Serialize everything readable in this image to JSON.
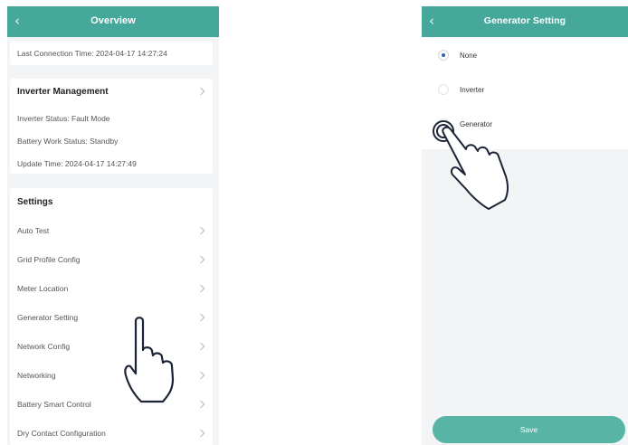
{
  "overview": {
    "header": {
      "back_icon": "chevron-left-icon",
      "title": "Overview"
    },
    "connection": {
      "last_connection": "Last Connection Time: 2024-04-17 14:27:24"
    },
    "inverter_management": {
      "title": "Inverter Management",
      "inverter_status": "Inverter Status: Fault Mode",
      "battery_work_status": "Battery Work Status: Standby",
      "update_time": "Update Time: 2024-04-17 14:27:49"
    },
    "settings": {
      "title": "Settings",
      "items": [
        {
          "label": "Auto Test"
        },
        {
          "label": "Grid Profile Config"
        },
        {
          "label": "Meter Location"
        },
        {
          "label": "Generator Setting"
        },
        {
          "label": "Network Config"
        },
        {
          "label": "Networking"
        },
        {
          "label": "Battery Smart Control"
        },
        {
          "label": "Dry Contact Configuration"
        }
      ]
    }
  },
  "generator_setting": {
    "header": {
      "back_icon": "chevron-left-icon",
      "title": "Generator Setting"
    },
    "options": [
      {
        "label": "None",
        "selected": true
      },
      {
        "label": "Inverter",
        "selected": false
      },
      {
        "label": "Generator",
        "selected": false
      }
    ],
    "save_label": "Save"
  },
  "colors": {
    "header": "#45a89a",
    "save_button": "#58b5a6",
    "radio_selected": "#2a63b8"
  }
}
